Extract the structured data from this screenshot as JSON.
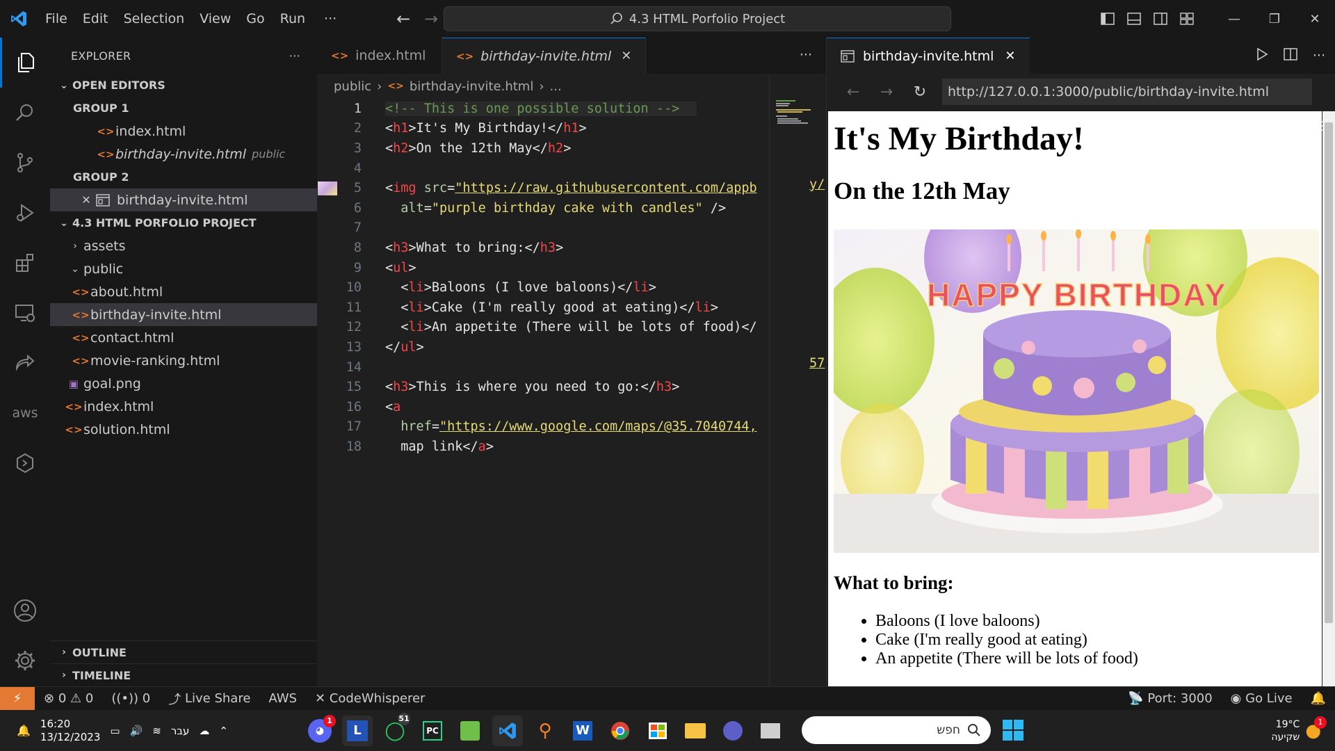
{
  "titlebar": {
    "menu": [
      "File",
      "Edit",
      "Selection",
      "View",
      "Go",
      "Run"
    ],
    "more": "···",
    "command_center": "4.3 HTML Porfolio Project"
  },
  "sidebar": {
    "title": "EXPLORER",
    "more": "···",
    "open_editors": "OPEN EDITORS",
    "group1": "GROUP 1",
    "group1_files": [
      {
        "name": "index.html",
        "desc": ""
      },
      {
        "name": "birthday-invite.html",
        "desc": "public"
      }
    ],
    "group2": "GROUP 2",
    "group2_files": [
      {
        "name": "birthday-invite.html"
      }
    ],
    "project": "4.3 HTML PORFOLIO PROJECT",
    "tree": {
      "assets": "assets",
      "public": "public",
      "public_files": [
        "about.html",
        "birthday-invite.html",
        "contact.html",
        "movie-ranking.html"
      ],
      "root_files": [
        "goal.png",
        "index.html",
        "solution.html"
      ]
    },
    "outline": "OUTLINE",
    "timeline": "TIMELINE"
  },
  "editor": {
    "tabs": [
      {
        "label": "index.html",
        "active": false
      },
      {
        "label": "birthday-invite.html",
        "active": true
      }
    ],
    "breadcrumb": [
      "public",
      "birthday-invite.html",
      "..."
    ],
    "line_numbers": [
      "1",
      "2",
      "3",
      "4",
      "5",
      "6",
      "7",
      "8",
      "9",
      "10",
      "11",
      "12",
      "13",
      "14",
      "15",
      "16",
      "17",
      "18"
    ],
    "code": {
      "l1": "<!-- This is one possible solution -->",
      "l2_open": "h1",
      "l2_text": "It's My Birthday!",
      "l3_open": "h2",
      "l3_text": "On the 12th May",
      "l5_tag": "img",
      "l5_attr": "src",
      "l5_val": "\"https://raw.githubusercontent.com/appb",
      "l5_overflow": "y/",
      "l6_attr": "alt",
      "l6_val": "\"purple birthday cake with candles\"",
      "l6_end": " />",
      "l8_open": "h3",
      "l8_text": "What to bring:",
      "l9_tag": "ul",
      "l10_tag": "li",
      "l10_text": "Baloons (I love baloons)",
      "l11_tag": "li",
      "l11_text": "Cake (I'm really good at eating)",
      "l12_tag": "li",
      "l12_text": "An appetite (There will be lots of food)",
      "l13_tag": "ul",
      "l15_tag": "h3",
      "l15_text": "This is where you need to go:",
      "l16_tag": "a",
      "l17_attr": "href",
      "l17_val": "\"https://www.google.com/maps/@35.7040744,",
      "l17_overflow": "57",
      "l18_text": "map link",
      "l18_tag": "a"
    }
  },
  "preview": {
    "tab_label": "birthday-invite.html",
    "url": "http://127.0.0.1:3000/public/birthday-invite.html",
    "page": {
      "h1": "It's My Birthday!",
      "h2": "On the 12th May",
      "cake_text": "HAPPY BIRTHDAY",
      "h3": "What to bring:",
      "items": [
        "Baloons (I love baloons)",
        "Cake (I'm really good at eating)",
        "An appetite (There will be lots of food)"
      ]
    }
  },
  "statusbar": {
    "errors": "0",
    "warnings": "0",
    "ports": "0",
    "live_share": "Live Share",
    "aws": "AWS",
    "codewhisperer": "CodeWhisperer",
    "port": "Port: 3000",
    "go_live": "Go Live"
  },
  "taskbar": {
    "time": "16:20",
    "date": "13/12/2023",
    "language": "עבר",
    "search_placeholder": "חפש",
    "discord_badge": "1",
    "whatsapp_badge": "51",
    "weather_temp": "19°C",
    "weather_desc": "שקיעה",
    "weather_badge": "1",
    "app_letters": {
      "l": "L",
      "pc": "PC",
      "word": "W"
    }
  },
  "colors": {
    "accent": "#0078d4",
    "remote": "#e37933",
    "html_icon": "#e37933"
  }
}
